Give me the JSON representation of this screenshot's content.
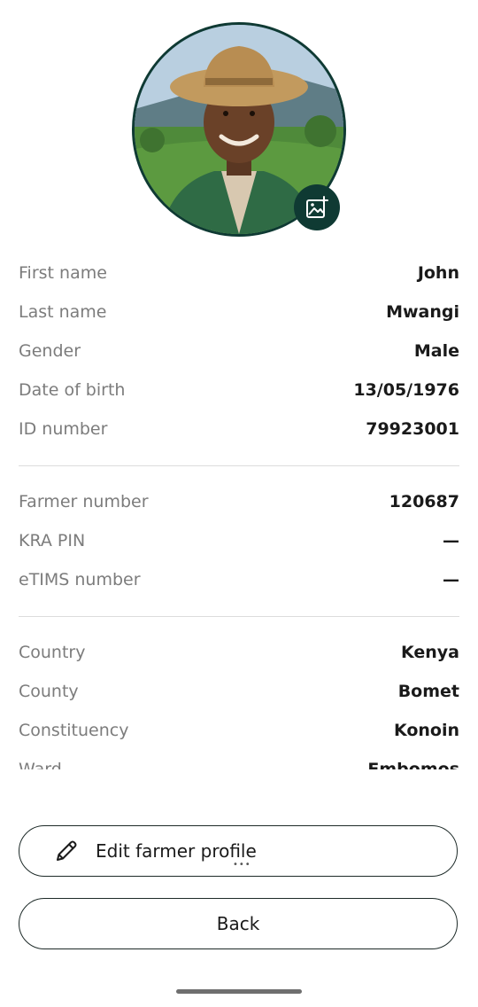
{
  "icons": {
    "add_photo": "add-photo-icon",
    "edit": "pencil-icon"
  },
  "colors": {
    "accent": "#0f3a33",
    "label": "#7c7c7c",
    "value": "#1a1a1a",
    "divider": "#dcdcdc"
  },
  "personal": [
    {
      "label": "First name",
      "value": "John"
    },
    {
      "label": "Last name",
      "value": "Mwangi"
    },
    {
      "label": "Gender",
      "value": "Male"
    },
    {
      "label": "Date of birth",
      "value": "13/05/1976"
    },
    {
      "label": "ID number",
      "value": "79923001"
    }
  ],
  "farmer": [
    {
      "label": "Farmer number",
      "value": "120687"
    },
    {
      "label": "KRA PIN",
      "value": "—"
    },
    {
      "label": "eTIMS number",
      "value": "—"
    }
  ],
  "location": [
    {
      "label": "Country",
      "value": "Kenya"
    },
    {
      "label": "County",
      "value": "Bomet"
    },
    {
      "label": "Constituency",
      "value": "Konoin"
    },
    {
      "label": "Ward",
      "value": "Embomos"
    }
  ],
  "actions": {
    "edit_label": "Edit farmer profile",
    "back_label": "Back"
  }
}
